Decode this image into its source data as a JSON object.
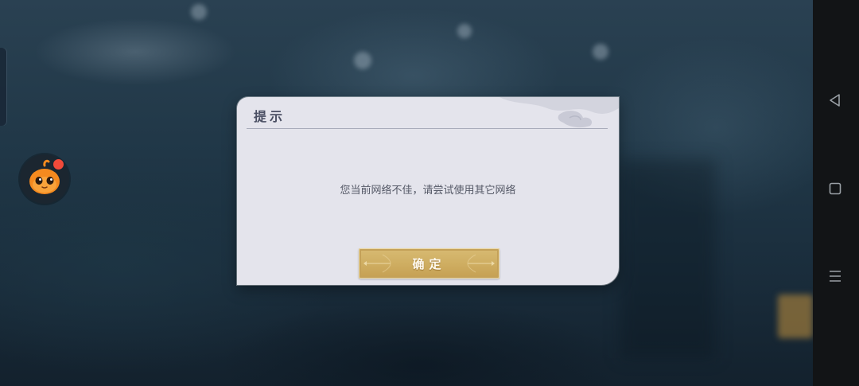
{
  "dialog": {
    "title": "提示",
    "message": "您当前网络不佳，请尝试使用其它网络",
    "confirm_label": "确定"
  },
  "floating_assistant": {
    "icon": "mascot-icon",
    "has_notification": true,
    "notification_color": "#f24a3a",
    "mascot_color": "#f58a1f"
  },
  "navigation_bar": {
    "buttons": [
      {
        "name": "back",
        "icon": "triangle-back-icon"
      },
      {
        "name": "home",
        "icon": "square-home-icon"
      },
      {
        "name": "recents",
        "icon": "menu-lines-icon"
      }
    ]
  },
  "colors": {
    "dialog_bg": "#e4e4ec",
    "dialog_text": "#545866",
    "button_gold": "#cfae62"
  }
}
